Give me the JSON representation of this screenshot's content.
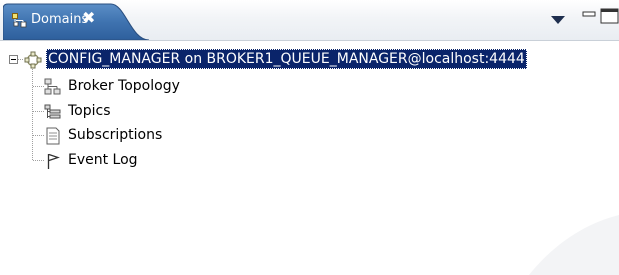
{
  "tab": {
    "title": "Domains",
    "close_glyph": "✖"
  },
  "toolbar": {
    "view_menu_icon": "dropdown-triangle-icon",
    "minimize_icon": "minimize-icon",
    "maximize_icon": "maximize-icon"
  },
  "tree": {
    "root": {
      "label": "CONFIG_MANAGER on BROKER1_QUEUE_MANAGER@localhost:4444",
      "icon": "config-manager-icon",
      "expanded": true,
      "selected": true
    },
    "children": [
      {
        "label": "Broker Topology",
        "icon": "topology-icon"
      },
      {
        "label": "Topics",
        "icon": "topics-icon"
      },
      {
        "label": "Subscriptions",
        "icon": "subscriptions-icon"
      },
      {
        "label": "Event Log",
        "icon": "flag-icon"
      }
    ]
  },
  "colors": {
    "tab_active": "#3a6ea5",
    "selection_bg": "#0a246a",
    "selection_fg": "#ffffff",
    "tree_line": "#a0a0a0"
  }
}
